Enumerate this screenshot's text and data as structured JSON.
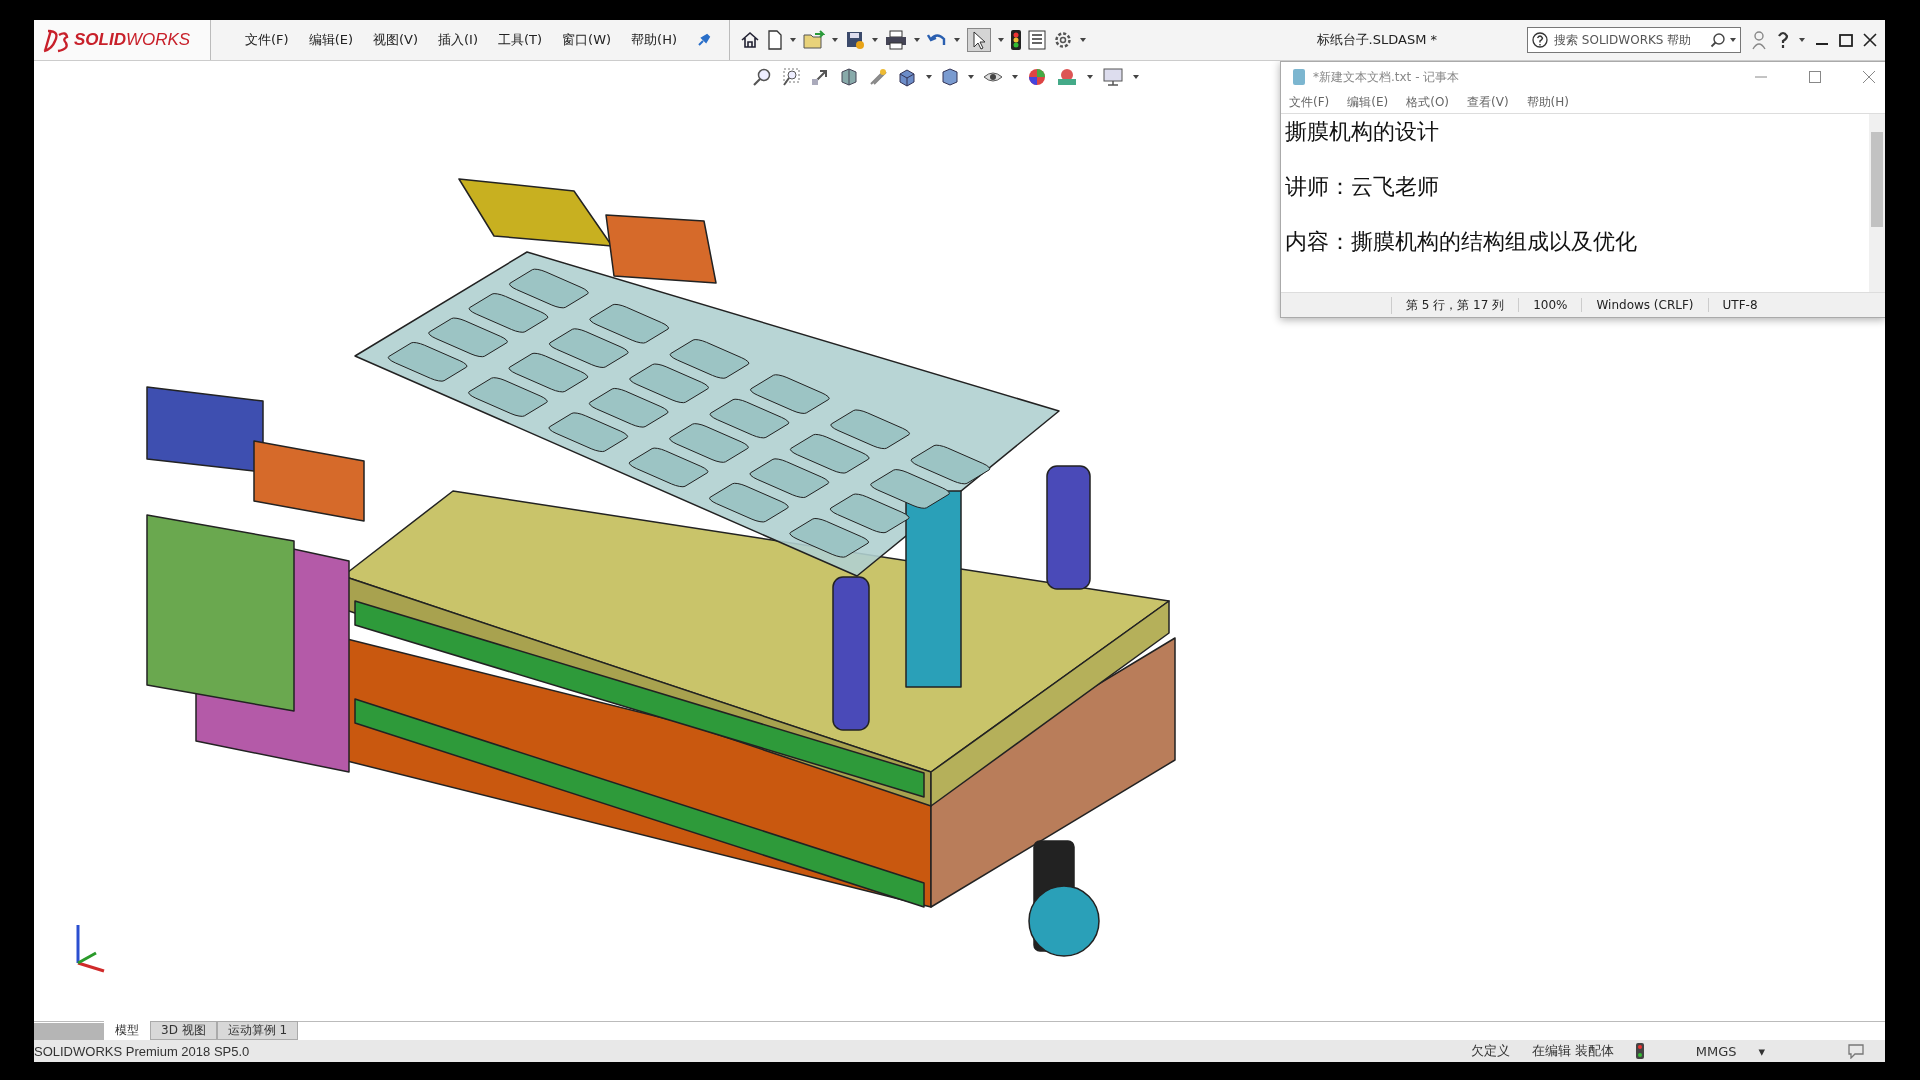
{
  "app": {
    "logo": "**SOLID**WORKS",
    "menu": [
      "文件(F)",
      "编辑(E)",
      "视图(V)",
      "插入(I)",
      "工具(T)",
      "窗口(W)",
      "帮助(H)"
    ]
  },
  "document_title": "标纸台子.SLDASM *",
  "search": {
    "placeholder": "搜索 SOLIDWORKS 帮助"
  },
  "notepad": {
    "title": "*新建文本文档.txt - 记事本",
    "menu": [
      "文件(F)",
      "编辑(E)",
      "格式(O)",
      "查看(V)",
      "帮助(H)"
    ],
    "lines": [
      "撕膜机构的设计",
      "讲师：云飞老师",
      "内容：撕膜机构的结构组成以及优化"
    ],
    "status": [
      "第 5 行，第 17 列",
      "100%",
      "Windows (CRLF)",
      "UTF-8"
    ]
  },
  "tabs": [
    {
      "label": "模型",
      "selected": true
    },
    {
      "label": "3D 视图",
      "selected": false
    },
    {
      "label": "运动算例 1",
      "selected": false
    }
  ],
  "status_bar": {
    "product": "SOLIDWORKS Premium 2018 SP5.0",
    "items": [
      "欠定义",
      "在编辑 装配体"
    ],
    "units": "MMGS",
    "units_caret": "▾"
  }
}
